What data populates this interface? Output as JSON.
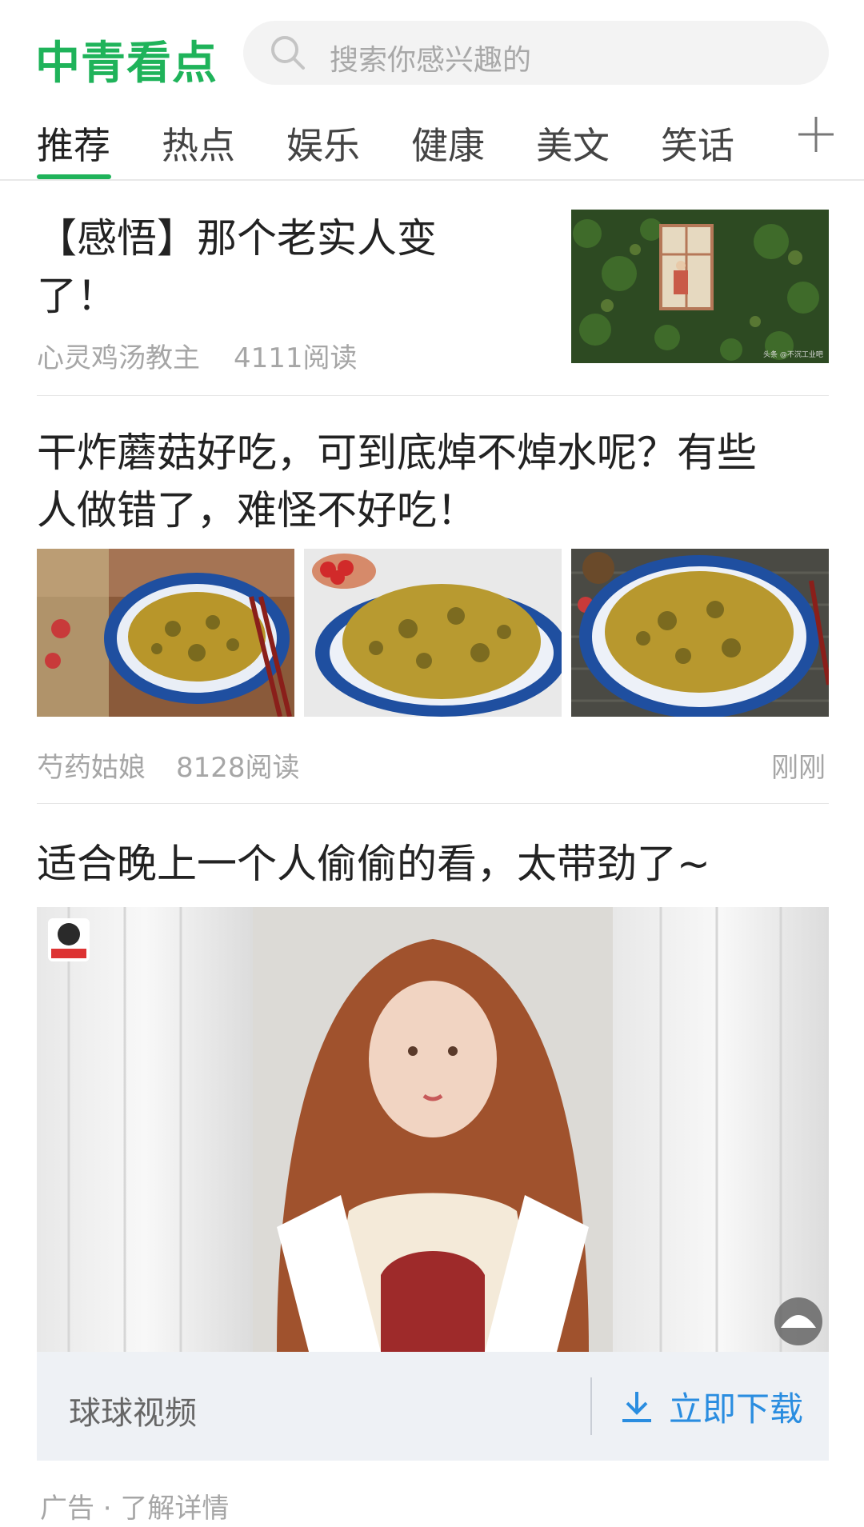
{
  "header": {
    "logo": "中青看点",
    "search_placeholder": "搜索你感兴趣的",
    "brand_color": "#1fb35a"
  },
  "tabs": [
    {
      "label": "推荐",
      "active": true
    },
    {
      "label": "热点",
      "active": false
    },
    {
      "label": "娱乐",
      "active": false
    },
    {
      "label": "健康",
      "active": false
    },
    {
      "label": "美文",
      "active": false
    },
    {
      "label": "笑话",
      "active": false
    }
  ],
  "add_tab_icon": "plus-icon",
  "articles": [
    {
      "title_line1": "【感悟】那个老实人变",
      "title_line2": "了！",
      "author": "心灵鸡汤教主",
      "reads": "4111阅读",
      "thumb_caption": "头条 @不沉工业吧"
    },
    {
      "title_line1": "干炸蘑菇好吃，可到底焯不焯水呢？有些",
      "title_line2": "人做错了，难怪不好吃！",
      "author": "芍药姑娘",
      "reads": "8128阅读",
      "time": "刚刚"
    },
    {
      "title": "适合晚上一个人偷偷的看，太带劲了~"
    }
  ],
  "ad": {
    "app_name": "球球视频",
    "download_label": "立即下载",
    "download_icon": "download-icon",
    "footer": "广告 · 了解详情",
    "cta_color": "#2a8de0"
  }
}
